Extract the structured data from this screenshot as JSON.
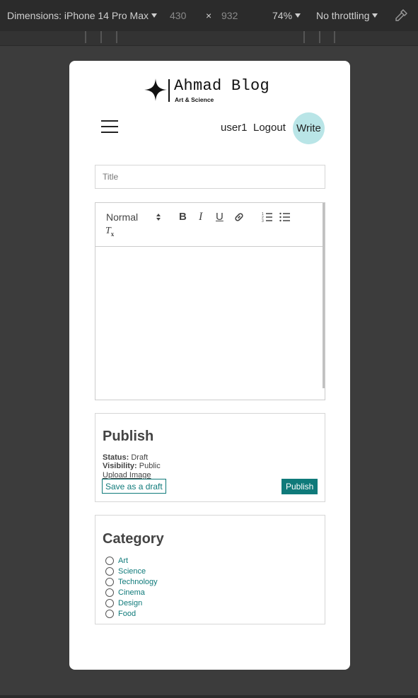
{
  "devtools": {
    "dimensions_label": "Dimensions: iPhone 14 Pro Max",
    "width": "430",
    "times": "×",
    "height": "932",
    "zoom": "74%",
    "throttling": "No throttling",
    "eyedropper_icon": "eyedropper-icon"
  },
  "logo": {
    "title": "Ahmad Blog",
    "subtitle": "Art & Science",
    "icon": "four-point-star-icon"
  },
  "nav": {
    "menu_icon": "hamburger-icon",
    "user": "user1",
    "logout": "Logout",
    "write": "Write"
  },
  "editor": {
    "title_placeholder": "Title",
    "format_select": "Normal",
    "bold": "B",
    "italic": "I",
    "underline": "U",
    "clean": "T",
    "clean_sub": "x"
  },
  "publish": {
    "heading": "Publish",
    "status_label": "Status:",
    "status_value": "Draft",
    "visibility_label": "Visibility:",
    "visibility_value": "Public",
    "upload": "Upload Image",
    "save_draft": "Save as a draft",
    "publish_button": "Publish"
  },
  "category": {
    "heading": "Category",
    "items": [
      "Art",
      "Science",
      "Technology",
      "Cinema",
      "Design",
      "Food"
    ]
  },
  "colors": {
    "accent": "#0f7a7a",
    "write_bubble": "#b9e5e7",
    "page_bg": "#3c3c3c"
  }
}
